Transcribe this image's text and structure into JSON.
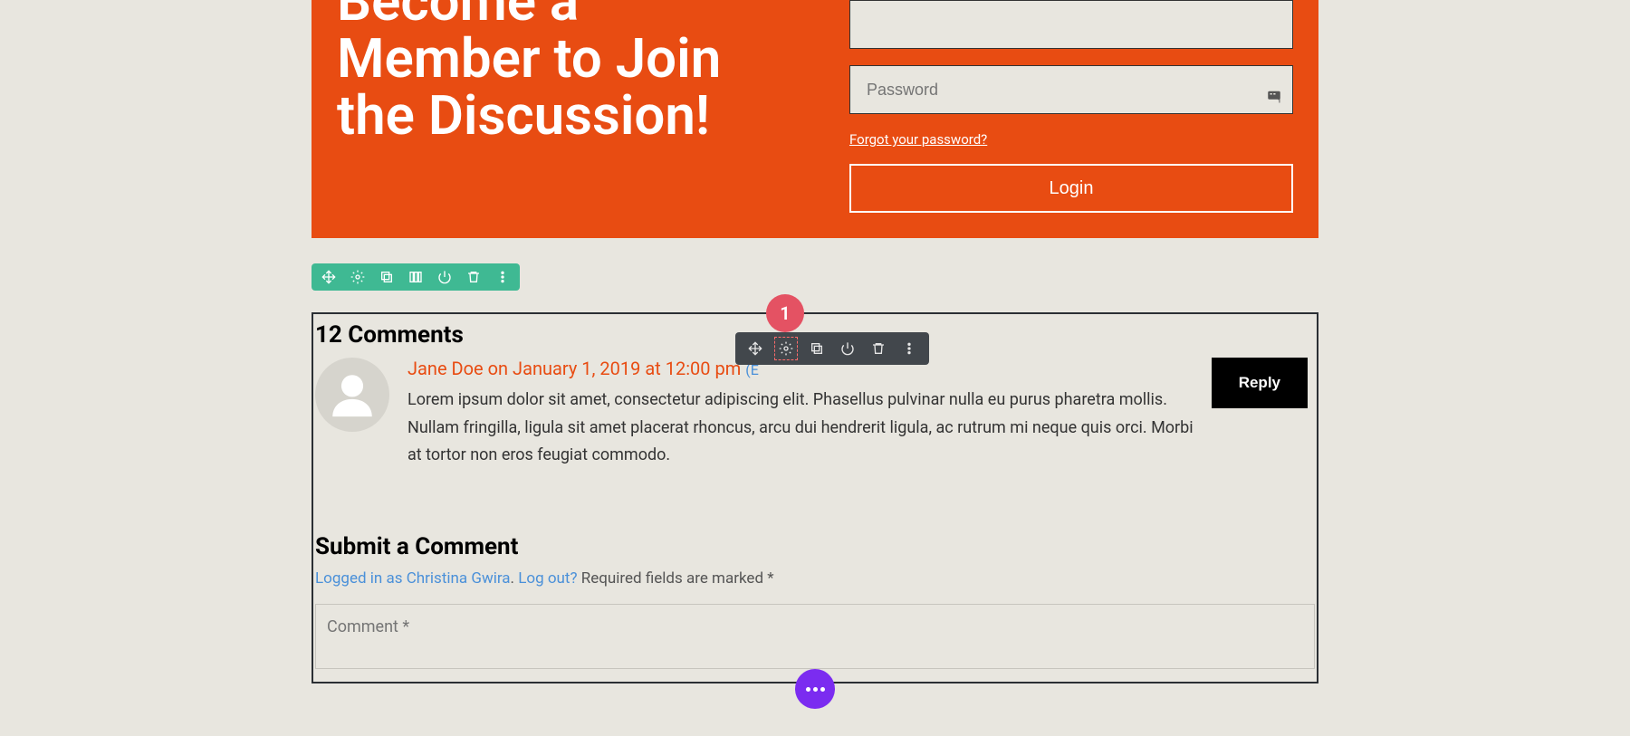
{
  "banner": {
    "title": "Become a Member to Join the Discussion!",
    "password_placeholder": "Password",
    "forgot": "Forgot your password?",
    "login": "Login"
  },
  "toolbar_green": {
    "icons": [
      "move",
      "settings",
      "clone",
      "columns",
      "power",
      "trash",
      "more"
    ]
  },
  "comments": {
    "count_label": "12 Comments",
    "items": [
      {
        "author": "Jane Doe",
        "meta_on": " on January 1, 2019 at 12:00 pm ",
        "edit": "(E",
        "text": "Lorem ipsum dolor sit amet, consectetur adipiscing elit. Phasellus pulvinar nulla eu purus pharetra mollis. Nullam fringilla, ligula sit amet placerat rhoncus, arcu dui hendrerit ligula, ac rutrum mi neque quis orci. Morbi at tortor non eros feugiat commodo.",
        "reply": "Reply"
      }
    ]
  },
  "float_toolbar": {
    "badge": "1",
    "icons": [
      "move",
      "settings",
      "clone",
      "power",
      "trash",
      "more"
    ]
  },
  "submit": {
    "title": "Submit a Comment",
    "logged_in_as": "Logged in as Christina Gwira",
    "sep": ". ",
    "logout": "Log out?",
    "required": " Required fields are marked *",
    "placeholder": "Comment *"
  }
}
